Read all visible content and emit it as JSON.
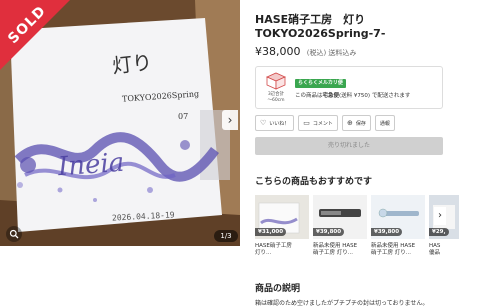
{
  "product": {
    "title": "HASE硝子工房　灯りTOKYO2026Spring-7-",
    "price": "¥38,000",
    "price_note": "(税込) 送料込み",
    "sold_label": "SOLD",
    "image_counter": "1/3",
    "photo_text_line1": "灯り",
    "photo_text_line2": "TOKYO2026Spring",
    "photo_text_line3": "07",
    "photo_date": "2026.04.18-19",
    "photo_signature": "Ineia"
  },
  "shipping": {
    "size_label": "3辺合計\n～60cm",
    "badge": "らくらくメルカリ便",
    "text_prefix": "この商品は",
    "method": "宅急便",
    "text_suffix": "(送料 ¥750) で配送されます"
  },
  "actions": {
    "like": "いいね！",
    "comment": "コメント",
    "save": "保存",
    "report": "通報"
  },
  "sold_button": "売り切れました",
  "recommend": {
    "title": "こちらの商品もおすすめです",
    "items": [
      {
        "price": "¥31,000",
        "name": "HASE硝子工房\n灯り..."
      },
      {
        "price": "¥39,800",
        "name": "新品未使用 HASE\n硝子工房 灯り..."
      },
      {
        "price": "¥39,800",
        "name": "新品未使用 HASE\n硝子工房 灯り..."
      },
      {
        "price": "¥29,",
        "name": "HAS\n優品"
      }
    ]
  },
  "description": {
    "title": "商品の説明",
    "text": "箱は確認のため空けましたがプチプチの封は切っておりません。"
  },
  "colors": {
    "sold_red": "#e02f3d",
    "ship_green": "#3aa64f",
    "ink_blue": "#5a4fb0"
  }
}
